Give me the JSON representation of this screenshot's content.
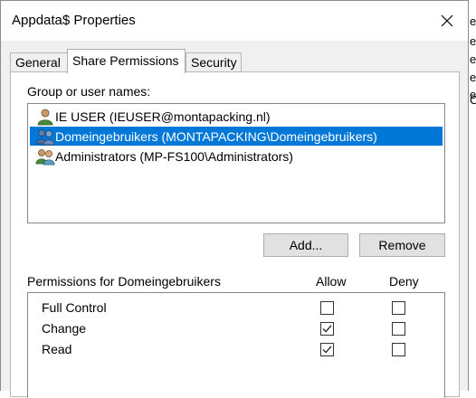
{
  "window": {
    "title": "Appdata$ Properties"
  },
  "tabs": [
    {
      "label": "General",
      "active": false
    },
    {
      "label": "Share Permissions",
      "active": true
    },
    {
      "label": "Security",
      "active": false
    }
  ],
  "users": {
    "label": "Group or user names:",
    "items": [
      {
        "name": "IE USER (IEUSER@montapacking.nl)",
        "icon": "single-user-icon",
        "selected": false
      },
      {
        "name": "Domeingebruikers (MONTAPACKING\\Domeingebruikers)",
        "icon": "user-group-icon",
        "selected": true
      },
      {
        "name": "Administrators (MP-FS100\\Administrators)",
        "icon": "user-group-icon",
        "selected": false
      }
    ]
  },
  "buttons": {
    "add": "Add...",
    "remove": "Remove"
  },
  "permissions": {
    "label": "Permissions for Domeingebruikers",
    "allow_header": "Allow",
    "deny_header": "Deny",
    "rows": [
      {
        "name": "Full Control",
        "allow": false,
        "deny": false
      },
      {
        "name": "Change",
        "allow": true,
        "deny": false
      },
      {
        "name": "Read",
        "allow": true,
        "deny": false
      }
    ]
  },
  "background_strip": [
    "e",
    "e",
    "e",
    "e",
    "e",
    "C"
  ],
  "colors": {
    "selection": "#0078d7",
    "panel": "#ffffff",
    "window": "#f0f0f0"
  }
}
